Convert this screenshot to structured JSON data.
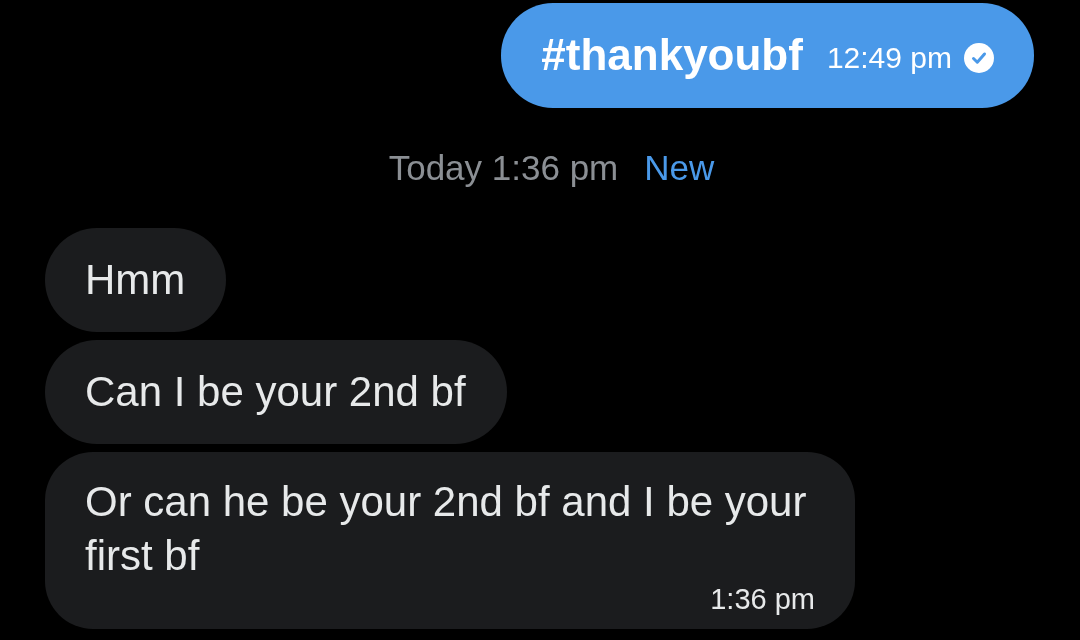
{
  "conversation": [
    {
      "kind": "sent",
      "text": "#thankyoubf",
      "time": "12:49 pm",
      "read": true
    },
    {
      "kind": "divider",
      "label": "Today 1:36 pm",
      "badge": "New"
    },
    {
      "kind": "received",
      "text": "Hmm"
    },
    {
      "kind": "received",
      "text": "Can I be your 2nd bf"
    },
    {
      "kind": "received",
      "text": "Or can he be your 2nd bf and I be your first bf",
      "time": "1:36 pm"
    }
  ]
}
